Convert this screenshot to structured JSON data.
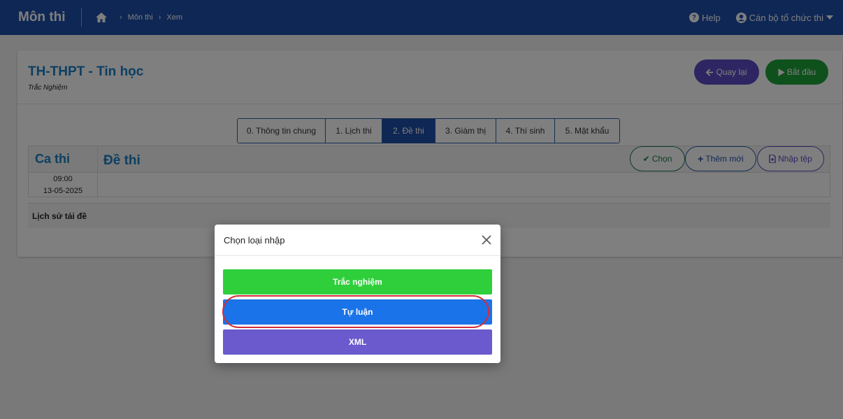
{
  "header": {
    "app_title": "Môn thi",
    "breadcrumb": [
      "Môn thi",
      "Xem"
    ],
    "help_label": "Help",
    "user_label": "Cán bộ tổ chức thi"
  },
  "subject": {
    "title": "TH-THPT - Tin học",
    "subtitle": "Trắc Nghiệm",
    "back_label": "Quay lại",
    "start_label": "Bắt đầu"
  },
  "tabs": [
    {
      "label": "0. Thông tin chung",
      "active": false
    },
    {
      "label": "1. Lịch thi",
      "active": false
    },
    {
      "label": "2. Đề thi",
      "active": true
    },
    {
      "label": "3. Giám thị",
      "active": false
    },
    {
      "label": "4. Thí sinh",
      "active": false
    },
    {
      "label": "5. Mật khẩu",
      "active": false
    }
  ],
  "grid": {
    "col_ca": "Ca thi",
    "col_de": "Đề thi",
    "slot_time": "09:00",
    "slot_date": "13-05-2025",
    "btn_chon": "Chọn",
    "btn_them": "Thêm mới",
    "btn_nhap": "Nhập tệp",
    "history_label": "Lịch sử tải đề"
  },
  "modal": {
    "title": "Chọn loại nhập",
    "options": [
      "Trắc nghiệm",
      "Tự luận",
      "XML"
    ]
  },
  "colors": {
    "header_bg": "#1f4fa8",
    "title_blue": "#1a7ec4",
    "green": "#2fcf3c",
    "blue": "#1a73e8",
    "purple": "#6a5acd",
    "highlight": "#d42d3a"
  }
}
